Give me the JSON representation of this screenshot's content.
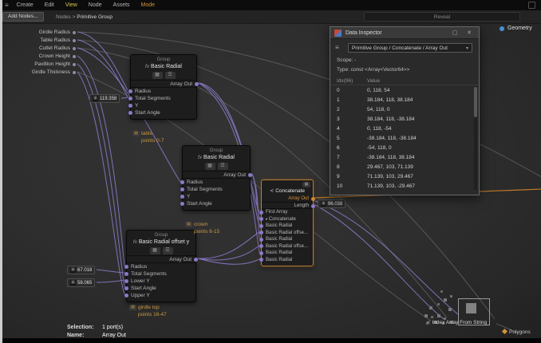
{
  "menubar": {
    "items": [
      "Create",
      "Edit",
      "View",
      "Node",
      "Assets",
      "Mode"
    ]
  },
  "toolbar": {
    "add_nodes": "Add Nodes...",
    "breadcrumb_root": "Nodes",
    "breadcrumb_sep": ">",
    "breadcrumb_current": "Primitive Group",
    "search_placeholder": "Reveal"
  },
  "params": {
    "items": [
      "Girdle Radius",
      "Table Radius",
      "Cutlet Radius",
      "Crown Height",
      "Pavillion Height",
      "Girdle Thickness"
    ]
  },
  "node1": {
    "group": "Group",
    "fx": "fx",
    "title": "Basic Radial",
    "output": "Array Out",
    "inputs": [
      "Radius",
      "Total Segments",
      "Y",
      "Start Angle"
    ],
    "comment": "table",
    "comment_sub": "points 0-7",
    "badge": "119.358"
  },
  "node2": {
    "group": "Group",
    "fx": "fx",
    "title": "Basic Radial",
    "output": "Array Out",
    "inputs": [
      "Radius",
      "Total Segments",
      "Y",
      "Start Angle"
    ],
    "comment": "crown",
    "comment_sub": "points 8-15"
  },
  "node3": {
    "group": "Group",
    "fx": "fx",
    "title": "Basic Radial offset y",
    "output": "Array Out",
    "inputs": [
      "Radius",
      "Total Segments",
      "Lower Y",
      "Start Angle",
      "Upper Y"
    ],
    "comment": "girdle top",
    "comment_sub": "points 16-47",
    "badge1": "67.018",
    "badge2": "58.065"
  },
  "concat": {
    "title": "Concatenate",
    "outputs": [
      "Array Out",
      "Length"
    ],
    "inputs": [
      "First Array",
      "Concatenate",
      "Basic Radial",
      "Basic Radial offse...",
      "Basic Radial",
      "Basic Radial offse...",
      "Basic Radial",
      "Basic Radial"
    ],
    "badge": "96.038"
  },
  "geometry": {
    "label": "Geometry"
  },
  "index_array": {
    "label": "Index Array From String"
  },
  "polygons": {
    "label": "Polygons"
  },
  "inspector": {
    "title": "Data Inspector",
    "dropdown": "Primitive Group / Concatenate / Array Out",
    "scope": "Scope: -",
    "type": "Type: const <Array<Vector64>>",
    "col_idx": "Idx(96)",
    "col_value": "Value",
    "rows": [
      {
        "idx": "0",
        "value": "0, 118, 54"
      },
      {
        "idx": "1",
        "value": "38.184, 118, 38.184"
      },
      {
        "idx": "2",
        "value": "54, 118, 0"
      },
      {
        "idx": "3",
        "value": "38.184, 118, -38.184"
      },
      {
        "idx": "4",
        "value": "0, 118, -54"
      },
      {
        "idx": "5",
        "value": "-38.184, 118, -38.184"
      },
      {
        "idx": "6",
        "value": "-54, 118, 0"
      },
      {
        "idx": "7",
        "value": "-38.184, 118, 38.184"
      },
      {
        "idx": "8",
        "value": "29.467, 103, 71.139"
      },
      {
        "idx": "9",
        "value": "71.139, 103, 29.467"
      },
      {
        "idx": "10",
        "value": "71.139, 103, -29.467"
      }
    ]
  },
  "status": {
    "selection_label": "Selection:",
    "selection_value": "1 port(s)",
    "name_label": "Name:",
    "name_value": "Array Out"
  },
  "icons": {
    "hamburger": "≡",
    "image": "▦",
    "list": "☰",
    "chevron_down": "▾",
    "close": "✕",
    "restore": "▢",
    "expander": "▸",
    "merge": "≺",
    "comment": "▤"
  },
  "colors": {
    "accent_orange": "#c8863c",
    "wire_purple": "#8b7ac6",
    "wire_gray": "#5e5e5e",
    "wire_orange": "#c07a28",
    "geometry_blue": "#4a8fd4"
  }
}
